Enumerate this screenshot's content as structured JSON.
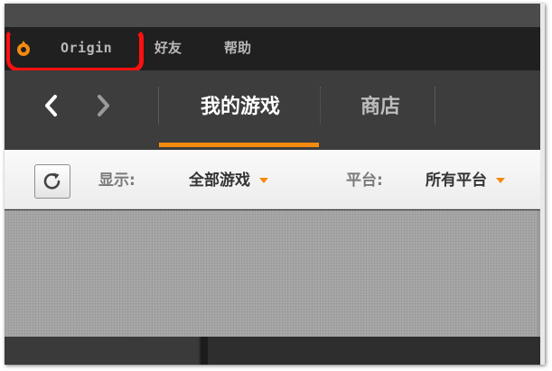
{
  "menubar": {
    "origin_label": "Origin",
    "friends_label": "好友",
    "help_label": "帮助",
    "logo_icon": "origin-logo-icon",
    "accent_color": "#f38b0f",
    "annotation_color": "#ff1010"
  },
  "nav": {
    "back_icon": "chevron-left-icon",
    "forward_icon": "chevron-right-icon",
    "tabs": [
      {
        "label": "我的游戏",
        "active": true
      },
      {
        "label": "商店",
        "active": false
      }
    ]
  },
  "filters": {
    "refresh_icon": "refresh-icon",
    "show_label": "显示:",
    "show_value": "全部游戏",
    "platform_label": "平台:",
    "platform_value": "所有平台"
  }
}
